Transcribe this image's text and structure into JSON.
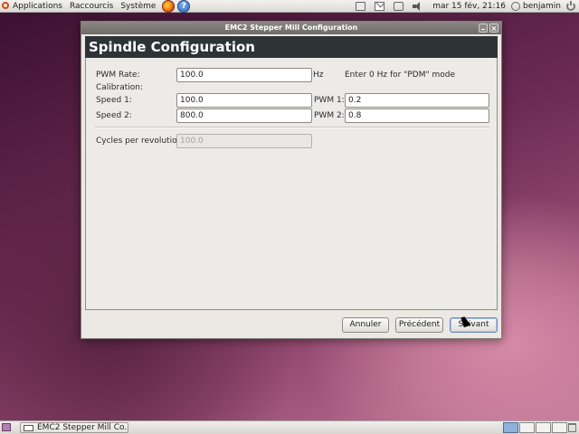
{
  "top_panel": {
    "menus": [
      "Applications",
      "Raccourcis",
      "Système"
    ],
    "clock": "mar 15 fév, 21:16",
    "user": "benjamin",
    "help_glyph": "?"
  },
  "window": {
    "title": "EMC2 Stepper Mill Configuration",
    "header": "Spindle Configuration",
    "pwm_rate": {
      "label": "PWM Rate:",
      "value": "100.0",
      "unit": "Hz",
      "hint": "Enter 0 Hz for \"PDM\" mode"
    },
    "calibration_label": "Calibration:",
    "speed1": {
      "label": "Speed 1:",
      "value": "100.0"
    },
    "speed2": {
      "label": "Speed 2:",
      "value": "800.0"
    },
    "pwm1": {
      "label": "PWM 1:",
      "value": "0.2"
    },
    "pwm2": {
      "label": "PWM 2:",
      "value": "0.8"
    },
    "cycles": {
      "label": "Cycles per revolution:",
      "value": "100.0",
      "disabled": true
    },
    "buttons": {
      "cancel": "Annuler",
      "previous": "Précédent",
      "next": "Suivant"
    }
  },
  "bottom_panel": {
    "task": "EMC2 Stepper Mill Co..."
  },
  "colors": {
    "header_bg": "#2e3436",
    "titlebar": "#6e6b68",
    "focus": "#6d8cbc"
  },
  "icons": [
    "ubuntu-logo-icon",
    "firefox-icon",
    "help-icon",
    "network-icon",
    "mail-icon",
    "volume-icon",
    "user-icon",
    "power-icon",
    "show-desktop-icon",
    "trash-icon"
  ]
}
